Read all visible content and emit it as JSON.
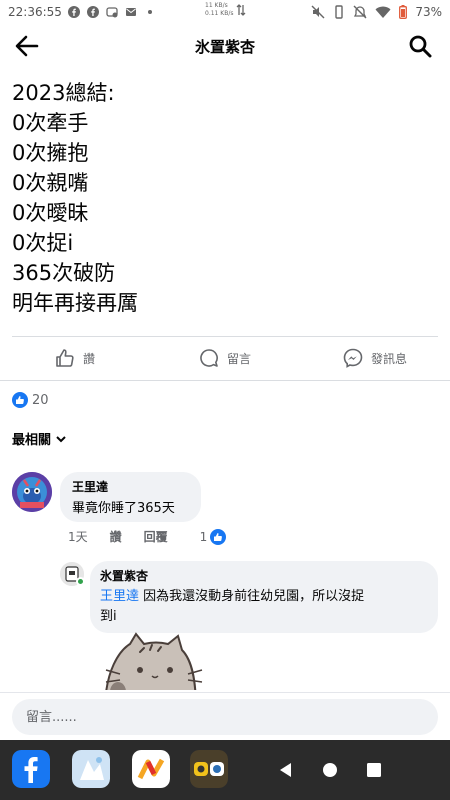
{
  "status_bar": {
    "time": "22:36:55",
    "center_top": "11 KB/s",
    "center_bottom": "0.11 KB/s",
    "battery": "73%",
    "icons": [
      "facebook-icon",
      "facebook-icon",
      "messenger-icon",
      "mail-icon",
      "dot-icon",
      "data-transfer-icon",
      "mute-icon",
      "vibrate-icon",
      "dnd-icon",
      "wifi-icon",
      "battery-icon"
    ]
  },
  "header": {
    "title": "氷置紫杏",
    "back_icon": "back-arrow-icon",
    "search_icon": "search-icon"
  },
  "post": {
    "lines": [
      "2023總結:",
      "0次牽手",
      "0次擁抱",
      "0次親嘴",
      "0次曖昧",
      "0次捉i",
      "365次破防",
      "明年再接再厲"
    ]
  },
  "actions": {
    "like": "讚",
    "comment": "留言",
    "message": "發訊息"
  },
  "reactions": {
    "count": "20"
  },
  "sort": {
    "label": "最相關"
  },
  "comments": [
    {
      "author": "王里達",
      "text": "畢竟你睡了365天",
      "time": "1天",
      "like_label": "讚",
      "reply_label": "回覆",
      "reaction_count": "1"
    }
  ],
  "reply": {
    "author": "氷置紫杏",
    "mention": "王里達",
    "text_line1": "因為我還沒動身前往幼兒園，所以沒捉",
    "text_line2": "到i"
  },
  "input": {
    "placeholder": "留言......"
  },
  "colors": {
    "brand": "#1877f2",
    "secondary_text": "#65676b",
    "bubble": "#f0f2f5",
    "nav": "#2b2b2b"
  }
}
